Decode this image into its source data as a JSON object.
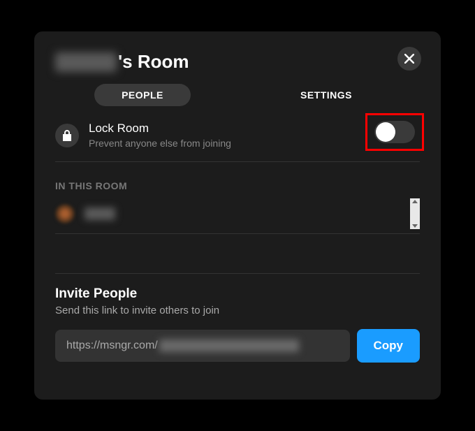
{
  "title_suffix": "'s Room",
  "tabs": {
    "people": "PEOPLE",
    "settings": "SETTINGS"
  },
  "lock": {
    "title": "Lock Room",
    "subtitle": "Prevent anyone else from joining",
    "enabled": false
  },
  "section_heading": "IN THIS ROOM",
  "participants": [
    {
      "name": "You"
    }
  ],
  "invite": {
    "title": "Invite People",
    "subtitle": "Send this link to invite others to join",
    "link_prefix": "https://msngr.com/",
    "copy_label": "Copy"
  },
  "colors": {
    "accent": "#1a9cff",
    "highlight": "#ff0000"
  }
}
